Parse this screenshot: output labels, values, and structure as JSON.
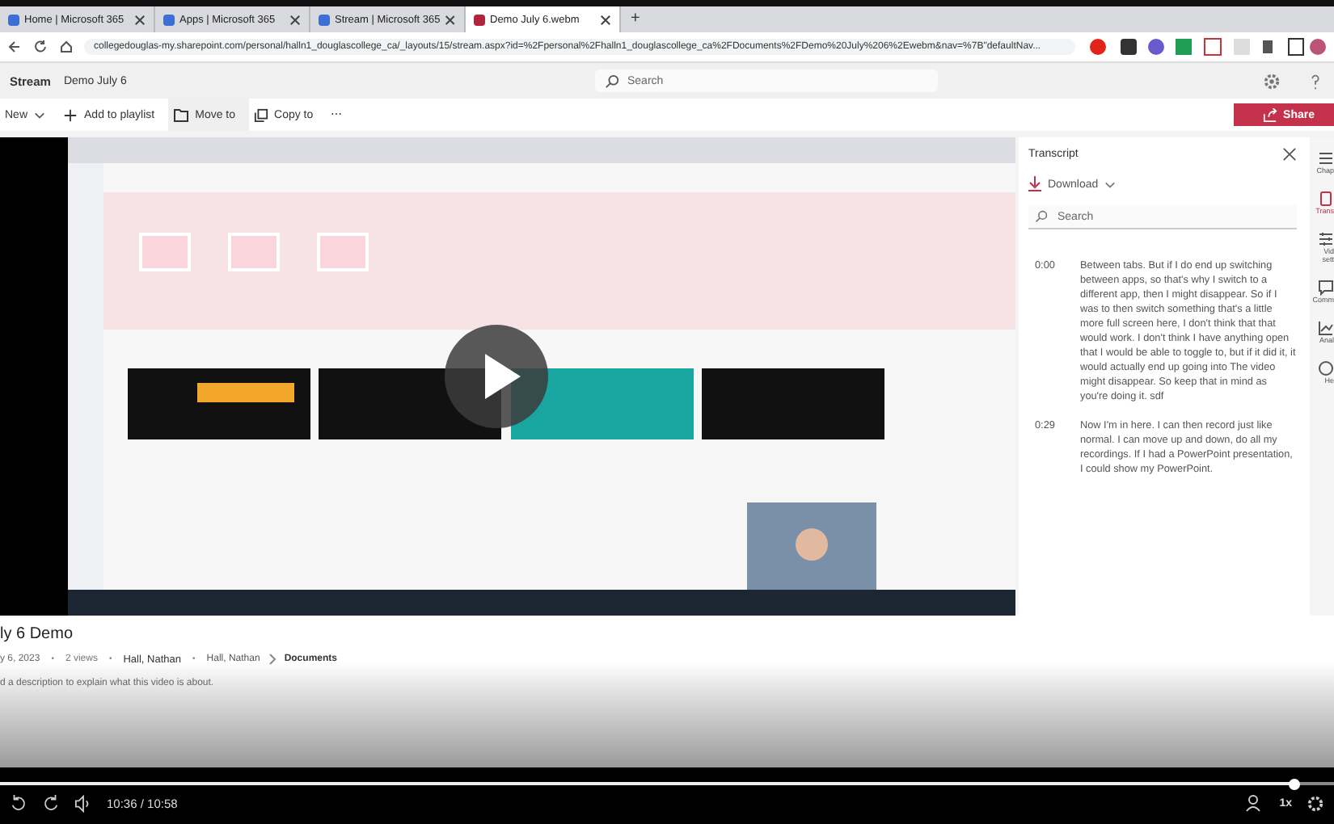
{
  "browser": {
    "tabs": [
      {
        "title": "Home | Microsoft 365",
        "selected": false
      },
      {
        "title": "Apps | Microsoft 365",
        "selected": false
      },
      {
        "title": "Stream | Microsoft 365",
        "selected": false
      },
      {
        "title": "Demo July 6.webm",
        "selected": true
      }
    ],
    "new_tab": "+",
    "url": "collegedouglas-my.sharepoint.com/personal/halln1_douglascollege_ca/_layouts/15/stream.aspx?id=%2Fpersonal%2Fhalln1_douglascollege_ca%2FDocuments%2FDemo%20July%206%2Ewebm&nav=%7B\"defaultNav..."
  },
  "header": {
    "app": "Stream",
    "file": "Demo July 6",
    "search_placeholder": "Search"
  },
  "commands": [
    {
      "label": "New",
      "kind": "dropdown"
    },
    {
      "label": "Add to playlist",
      "kind": "add"
    },
    {
      "label": "Move to",
      "kind": "move"
    },
    {
      "label": "Copy to",
      "kind": "copy"
    },
    {
      "label": "⋯",
      "kind": "more"
    }
  ],
  "share": "Share",
  "transcript": {
    "title": "Transcript",
    "download": "Download",
    "search_placeholder": "Search",
    "entries": [
      {
        "time": "0:00",
        "text": "Between tabs. But if I do end up switching between apps, so that's why I switch to a different app, then I might disappear. So if I was to then switch something that's a little more full screen here, I don't think that that would work. I don't think I have anything open that I would be able to toggle to, but if it did it, it would actually end up going into The video might disappear. So keep that in mind as you're doing it. sdf"
      },
      {
        "time": "0:29",
        "text": "Now I'm in here. I can then record just like normal. I can move up and down, do all my recordings. If I had a PowerPoint presentation, I could show my PowerPoint."
      }
    ]
  },
  "rail": [
    {
      "label": "Chap",
      "selected": false,
      "kind": "chapters"
    },
    {
      "label": "Trans",
      "selected": true,
      "kind": "transcript"
    },
    {
      "label": "Vid\nsett",
      "selected": false,
      "kind": "settings"
    },
    {
      "label": "Comm",
      "selected": false,
      "kind": "comments"
    },
    {
      "label": "Anal",
      "selected": false,
      "kind": "analytics"
    },
    {
      "label": "He",
      "selected": false,
      "kind": "help"
    }
  ],
  "info": {
    "title": "ly 6 Demo",
    "meta": [
      {
        "text": "y 6, 2023",
        "kind": "date"
      },
      {
        "text": "•",
        "kind": "separator"
      },
      {
        "text": "2 views",
        "kind": "views"
      },
      {
        "text": "•",
        "kind": "separator"
      },
      {
        "text": "Hall, Nathan",
        "kind": "owner"
      },
      {
        "text": "•",
        "kind": "separator"
      }
    ],
    "path": [
      "Hall, Nathan",
      "Documents"
    ],
    "description": "d a description to explain what this video is about."
  },
  "player": {
    "level": 0.97,
    "time": "10:36 / 10:58",
    "speed": "1x"
  }
}
